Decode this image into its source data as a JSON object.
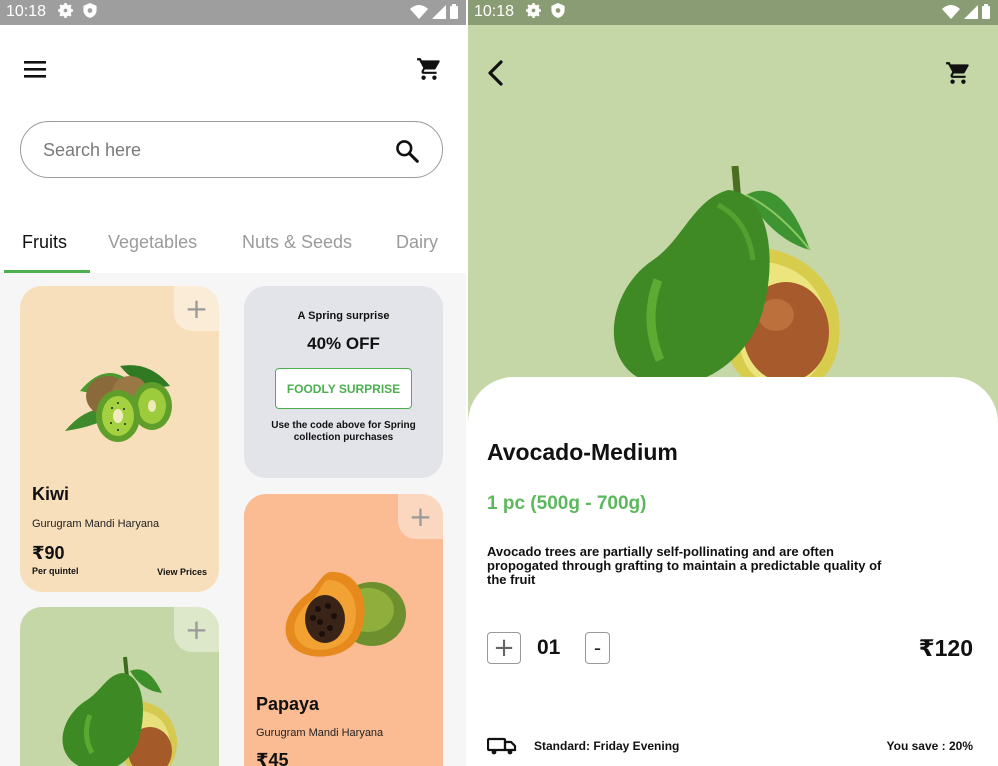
{
  "colors": {
    "accent": "#4caf50",
    "kiwi_card": "#f8dfbc",
    "avocado_card": "#c6d7a7",
    "papaya_card": "#fbbc94",
    "promo_card": "#e3e4e9"
  },
  "left": {
    "status": {
      "time": "10:18"
    },
    "header": {
      "menu_icon": "menu-icon",
      "cart_icon": "cart-icon"
    },
    "search": {
      "placeholder": "Search here",
      "value": ""
    },
    "tabs": [
      {
        "label": "Fruits",
        "active": true
      },
      {
        "label": "Vegetables",
        "active": false
      },
      {
        "label": "Nuts & Seeds",
        "active": false
      },
      {
        "label": "Dairy",
        "active": false
      }
    ],
    "cards": {
      "kiwi": {
        "name": "Kiwi",
        "location": "Gurugram Mandi Haryana",
        "price": "₹90",
        "unit": "Per quintel",
        "view": "View Prices",
        "plus": "+"
      },
      "promo": {
        "title": "A Spring surprise",
        "discount": "40% OFF",
        "code": "FOODLY SURPRISE",
        "note": "Use the code above for Spring collection purchases"
      },
      "avocado": {
        "plus": "+"
      },
      "papaya": {
        "name": "Papaya",
        "location": "Gurugram Mandi Haryana",
        "price": "₹45",
        "plus": "+"
      }
    }
  },
  "right": {
    "status": {
      "time": "10:18"
    },
    "header": {
      "back_icon": "back-icon",
      "cart_icon": "cart-icon"
    },
    "product": {
      "name": "Avocado-Medium",
      "weight": "1 pc (500g - 700g)",
      "description": "Avocado trees are partially self-pollinating and are often propogated through grafting to maintain a predictable quality of the fruit",
      "quantity": "01",
      "plus": "+",
      "minus": "-",
      "price": "₹120"
    },
    "delivery": {
      "icon": "truck-icon",
      "text": "Standard: Friday Evening",
      "saving": "You save : 20%"
    }
  }
}
